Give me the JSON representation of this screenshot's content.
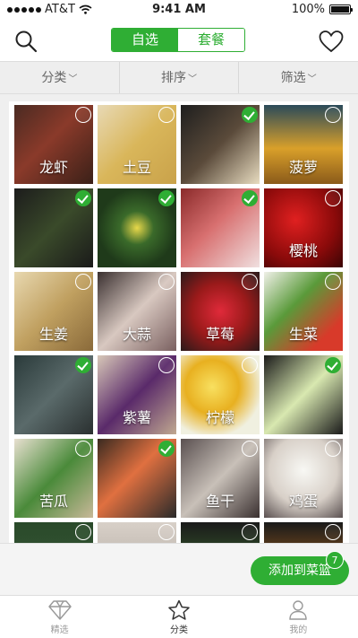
{
  "status_bar": {
    "carrier": "AT&T",
    "time": "9:41 AM",
    "battery": "100%"
  },
  "nav": {
    "segment_left": "自选",
    "segment_right": "套餐"
  },
  "filters": [
    {
      "label": "分类"
    },
    {
      "label": "排序"
    },
    {
      "label": "筛选"
    }
  ],
  "colors": {
    "accent": "#2fae34"
  },
  "tiles": [
    {
      "label": "龙虾",
      "checked": false,
      "bg": "linear-gradient(135deg,#4a2a22,#8a3a2a 45%,#3a2018)"
    },
    {
      "label": "土豆",
      "checked": false,
      "bg": "linear-gradient(135deg,#e8d9b5,#d9b65a 50%,#c9a24a)"
    },
    {
      "label": "",
      "checked": true,
      "bg": "linear-gradient(135deg,#1e1e1e,#5a4a3a 50%,#e8dcc0)"
    },
    {
      "label": "菠萝",
      "checked": false,
      "bg": "linear-gradient(180deg,#2a4a5a,#d9a02a 55%,#8a5a1a)"
    },
    {
      "label": "",
      "checked": true,
      "bg": "linear-gradient(135deg,#1c1c1c,#3a4a2a 50%,#1a1a1a)"
    },
    {
      "label": "",
      "checked": true,
      "bg": "radial-gradient(circle at 50% 50%,#e8d84a 0,#3a6a2a 30%,#1f3a1a 70%)"
    },
    {
      "label": "",
      "checked": true,
      "bg": "linear-gradient(135deg,#8a2a2a,#d87070 45%,#f0e0e0)"
    },
    {
      "label": "樱桃",
      "checked": false,
      "bg": "radial-gradient(circle at 40% 40%,#e02020,#8a0a0a 60%,#3a0505)"
    },
    {
      "label": "生姜",
      "checked": false,
      "bg": "linear-gradient(135deg,#e8d8b0,#c0a060 50%,#8a6a3a)"
    },
    {
      "label": "大蒜",
      "checked": false,
      "bg": "linear-gradient(135deg,#3a3030,#d8c8c0 50%,#7a6060)"
    },
    {
      "label": "草莓",
      "checked": false,
      "bg": "radial-gradient(circle at 50% 50%,#e02a3a,#9a1a1a 50%,#2a1a1a)"
    },
    {
      "label": "生菜",
      "checked": false,
      "bg": "linear-gradient(135deg,#f0f0e8,#5a9a3a 40%,#d83a2a 80%)"
    },
    {
      "label": "",
      "checked": true,
      "bg": "linear-gradient(135deg,#2a3a3a,#5a6a6a 50%,#2a3030)"
    },
    {
      "label": "紫薯",
      "checked": false,
      "bg": "linear-gradient(135deg,#d8c8b8,#5a2a6a 50%,#c0a890)"
    },
    {
      "label": "柠檬",
      "checked": false,
      "bg": "radial-gradient(circle at 40% 40%,#f8e060,#e8b020 40%,#f0f0e0 75%)"
    },
    {
      "label": "",
      "checked": true,
      "bg": "linear-gradient(135deg,#1a1a1a,#d8e8b0 50%,#1a1a1a)"
    },
    {
      "label": "苦瓜",
      "checked": false,
      "bg": "linear-gradient(135deg,#e8e0d0,#4a8a3a 50%,#c8b898)"
    },
    {
      "label": "",
      "checked": true,
      "bg": "linear-gradient(135deg,#3a2a20,#e07040 45%,#2a2a2a)"
    },
    {
      "label": "鱼干",
      "checked": false,
      "bg": "linear-gradient(135deg,#5a5050,#c8c0b8 50%,#3a3030)"
    },
    {
      "label": "鸡蛋",
      "checked": false,
      "bg": "radial-gradient(circle at 50% 40%,#f8f8f4,#d8d0c8 55%,#5a5050)"
    },
    {
      "label": "",
      "checked": false,
      "bg": "linear-gradient(180deg,#2a4a2a,#3a5a3a)"
    },
    {
      "label": "",
      "checked": false,
      "bg": "linear-gradient(180deg,#d8d0c8,#a8a098)"
    },
    {
      "label": "",
      "checked": false,
      "bg": "linear-gradient(180deg,#1a1a1a,#4a8a3a)"
    },
    {
      "label": "",
      "checked": false,
      "bg": "linear-gradient(180deg,#1a1a1a,#e08020)"
    }
  ],
  "action": {
    "add_label": "添加到菜篮",
    "badge_count": "7"
  },
  "tabs": [
    {
      "label": "精选",
      "icon": "diamond-icon"
    },
    {
      "label": "分类",
      "icon": "star-icon"
    },
    {
      "label": "我的",
      "icon": "user-icon"
    }
  ]
}
